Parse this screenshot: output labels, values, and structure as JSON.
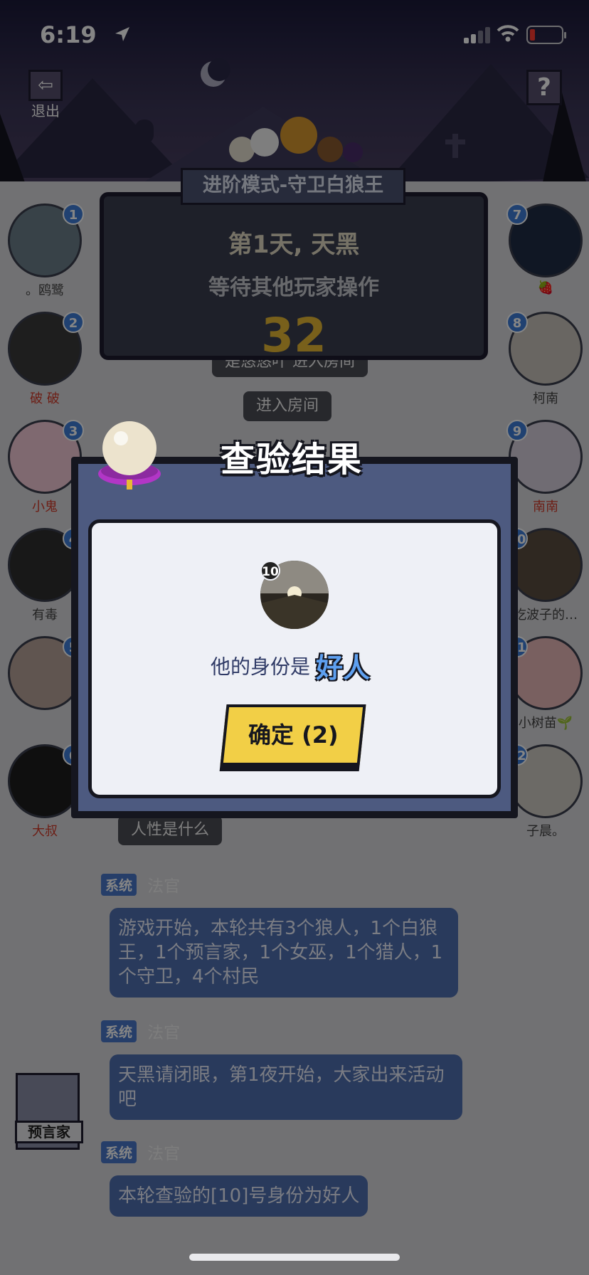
{
  "status_bar": {
    "time": "6:19"
  },
  "header": {
    "exit_label": "退出",
    "help_label": "?",
    "mode_title": "进阶模式-守卫白狼王"
  },
  "board": {
    "day_label": "第1天, 天黑",
    "wait_label": "等待其他玩家操作",
    "countdown": "32"
  },
  "players_left": [
    {
      "num": "1",
      "name": "。鸥鹭",
      "red": false,
      "color": "#6b7f8a"
    },
    {
      "num": "2",
      "name": "破 破",
      "red": true,
      "color": "#3a3a3a"
    },
    {
      "num": "3",
      "name": "小鬼",
      "red": true,
      "color": "#f4c9d6"
    },
    {
      "num": "4",
      "name": "有毒",
      "red": false,
      "color": "#2e2e2e"
    },
    {
      "num": "5",
      "name": "",
      "red": false,
      "color": "#b8a39a"
    },
    {
      "num": "6",
      "name": "大叔",
      "red": true,
      "color": "#1e1e1e"
    }
  ],
  "players_right": [
    {
      "num": "7",
      "name": "🍓",
      "red": false,
      "color": "#1f2d45"
    },
    {
      "num": "8",
      "name": "柯南",
      "red": false,
      "color": "#c9c4bc"
    },
    {
      "num": "9",
      "name": "南南",
      "red": true,
      "color": "#d7d0dc"
    },
    {
      "num": "10",
      "name": "吃波子的…",
      "red": false,
      "color": "#5a4e40"
    },
    {
      "num": "11",
      "name": "小树苗🌱",
      "red": false,
      "color": "#e8b8b8"
    },
    {
      "num": "12",
      "name": "子晨。",
      "red": false,
      "color": "#cfcbc4"
    }
  ],
  "chat": {
    "chips": [
      "是悠悠叶 进入房间",
      "进入房间",
      "人性是什么"
    ],
    "messages": [
      {
        "tag": "系统",
        "sender": "法官",
        "text": "游戏开始，本轮共有3个狼人，1个白狼王，1个预言家，1个女巫，1个猎人，1个守卫，4个村民"
      },
      {
        "tag": "系统",
        "sender": "法官",
        "text": "天黑请闭眼，第1夜开始，大家出来活动吧"
      },
      {
        "tag": "系统",
        "sender": "法官",
        "text": "本轮查验的[10]号身份为好人"
      }
    ]
  },
  "role_card": {
    "label": "预言家"
  },
  "modal": {
    "title": "查验结果",
    "target_num": "10",
    "result_prefix": "他的身份是",
    "result_value": "好人",
    "confirm_label": "确定 (2)"
  },
  "colors": {
    "accent_blue": "#3f7ed8",
    "confirm_yellow": "#f2cf46",
    "countdown_gold": "#e7b934"
  }
}
